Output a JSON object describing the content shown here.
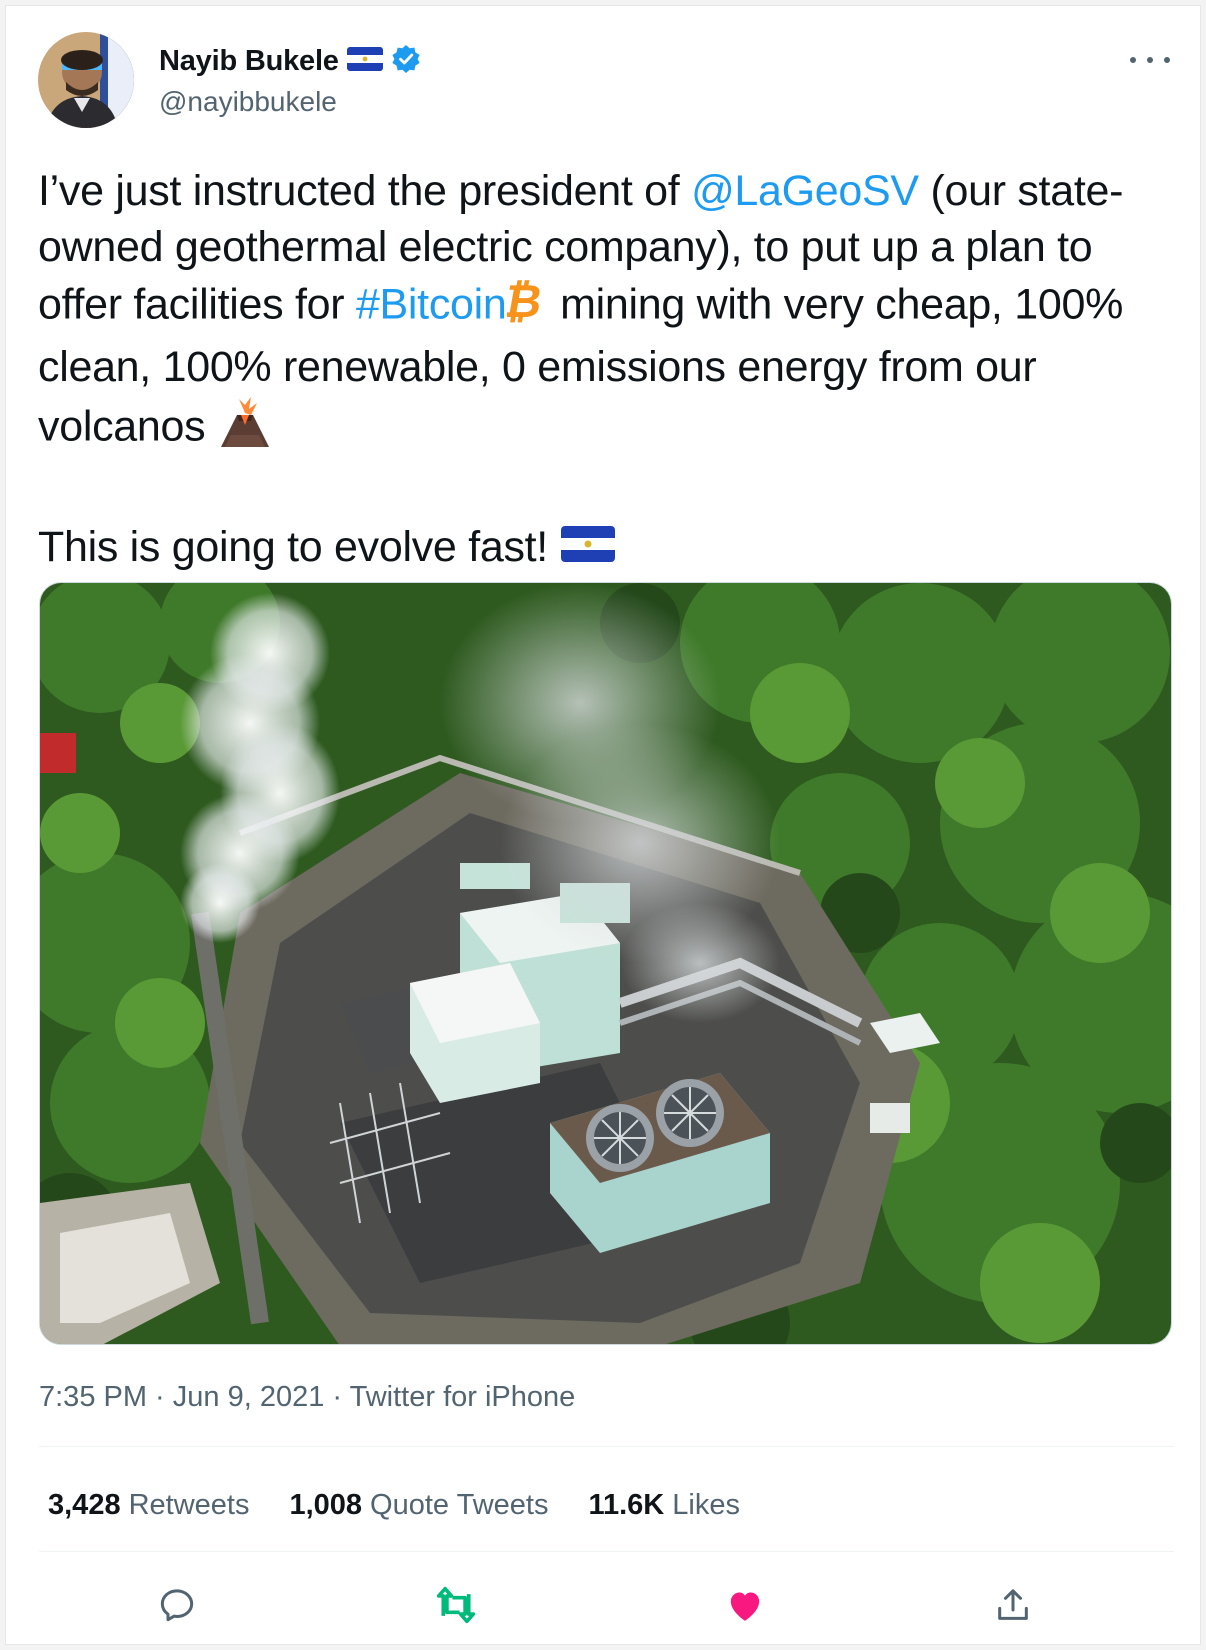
{
  "author": {
    "name": "Nayib Bukele",
    "handle": "@nayibbukele",
    "verified": true,
    "flag_icon": "el-salvador-flag-icon"
  },
  "tweet": {
    "line1_pre": "I’ve just instructed the president of ",
    "mention": "@LaGeoSV",
    "line1_post": " (our state-owned geothermal electric company), to put up a plan to offer facilities for ",
    "hashtag": "#Bitcoin",
    "line1_post2": "  mining with very cheap, 100% clean, 100% renewable, 0 emissions energy from our volcanos ",
    "line2": "This is going to evolve fast! "
  },
  "meta": {
    "time": "7:35 PM",
    "sep1": " · ",
    "date": "Jun 9, 2021",
    "sep2": " · ",
    "source": "Twitter for iPhone"
  },
  "stats": {
    "retweets_count": "3,428",
    "retweets_label": "Retweets",
    "quotes_count": "1,008",
    "quotes_label": "Quote Tweets",
    "likes_count": "11.6K",
    "likes_label": "Likes"
  },
  "colors": {
    "link": "#1d9bf0",
    "retweet_active": "#00ba7c",
    "like_active": "#f91880",
    "muted": "#536471"
  },
  "icons": [
    "reply-icon",
    "retweet-icon",
    "like-icon",
    "share-icon",
    "more-icon",
    "verified-icon",
    "bitcoin-icon",
    "volcano-icon"
  ]
}
